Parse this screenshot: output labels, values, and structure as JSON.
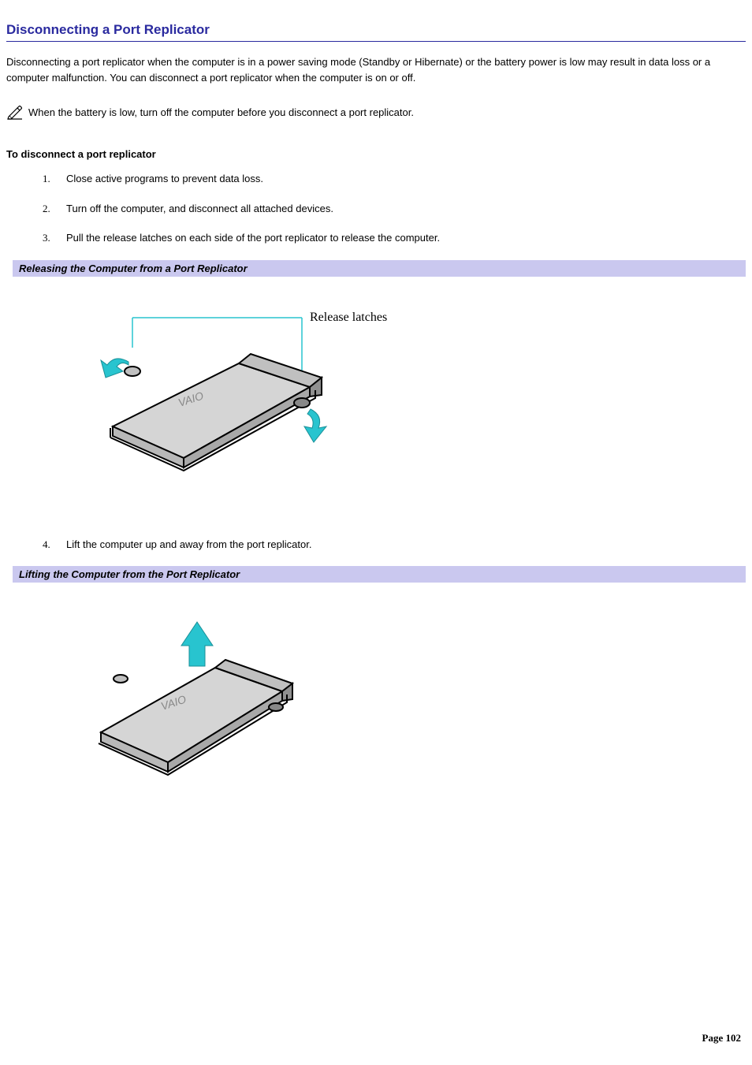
{
  "heading": "Disconnecting a Port Replicator",
  "intro": "Disconnecting a port replicator when the computer is in a power saving mode (Standby or Hibernate) or the battery power is low may result in data loss or a computer malfunction. You can disconnect a port replicator when the computer is on or off.",
  "note": "When the battery is low, turn off the computer before you disconnect a port replicator.",
  "procedure_heading": "To disconnect a port replicator",
  "steps": {
    "s1": "Close active programs to prevent data loss.",
    "s2": "Turn off the computer, and disconnect all attached devices.",
    "s3": "Pull the release latches on each side of the port replicator to release the computer.",
    "s4": "Lift the computer up and away from the port replicator."
  },
  "caption1": "Releasing the Computer from a Port Replicator",
  "caption2": "Lifting the Computer from the Port Replicator",
  "callout1": "Release latches",
  "page_label": "Page 102"
}
